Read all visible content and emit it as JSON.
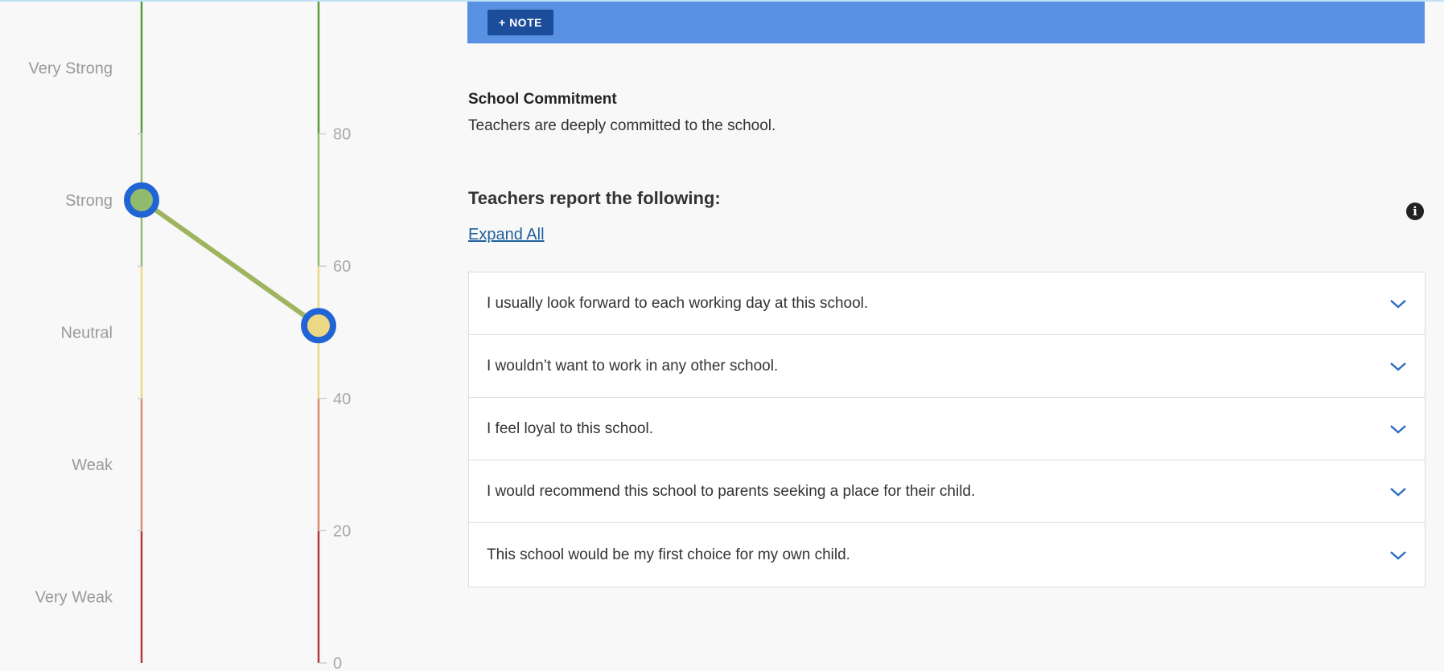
{
  "scale": {
    "left_labels": [
      "Very Strong",
      "Strong",
      "Neutral",
      "Weak",
      "Very Weak"
    ],
    "right_ticks": [
      "80",
      "60",
      "40",
      "20",
      "0"
    ],
    "colors": {
      "very_strong": "#5a9a3a",
      "strong": "#8fbb6f",
      "neutral": "#ecd784",
      "weak": "#d98a6c",
      "very_weak": "#b23a3a",
      "marker_ring": "#2164d6",
      "connector": "#9fb45f"
    }
  },
  "comparison": {
    "left_level": "Strong",
    "right_value": 51
  },
  "note_button": {
    "icon": "plus-icon",
    "label": "+ NOTE"
  },
  "section": {
    "title": "School Commitment",
    "description": "Teachers are deeply committed to the school."
  },
  "report": {
    "heading": "Teachers report the following:",
    "expand_all": "Expand All",
    "info_icon": "info-icon",
    "items": [
      "I usually look forward to each working day at this school.",
      "I wouldn’t want to work in any other school.",
      "I feel loyal to this school.",
      "I would recommend this school to parents seeking a place for their child.",
      "This school would be my first choice for my own child."
    ]
  }
}
